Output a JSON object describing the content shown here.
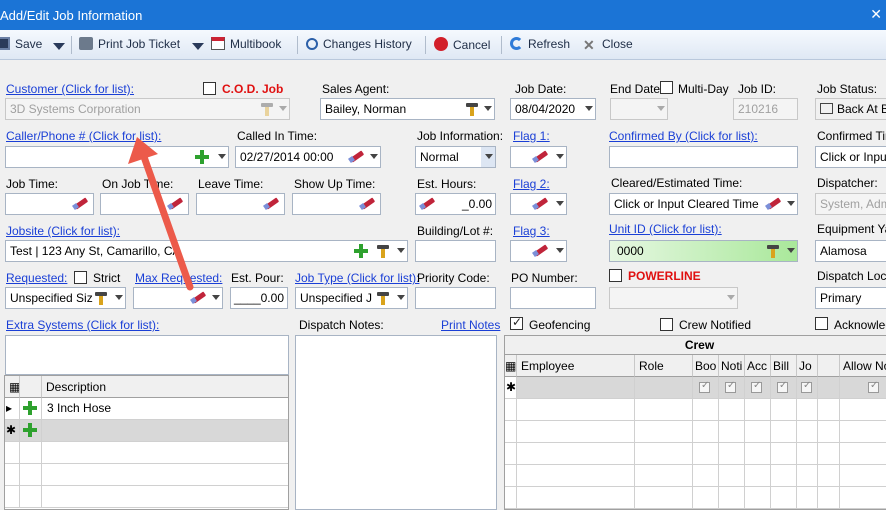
{
  "window": {
    "title": "Add/Edit Job Information",
    "close": "✕"
  },
  "toolbar": {
    "save": "Save",
    "print_ticket": "Print Job Ticket",
    "multibook": "Multibook",
    "changes_history": "Changes History",
    "cancel": "Cancel",
    "refresh": "Refresh",
    "close": "Close"
  },
  "customer": {
    "label": "Customer (Click for list):",
    "value": "3D Systems Corporation",
    "cod_label": "C.O.D. Job"
  },
  "sales_agent": {
    "label": "Sales Agent:",
    "value": "Bailey, Norman"
  },
  "job_date": {
    "label": "Job Date:",
    "value": "08/04/2020"
  },
  "end_date": {
    "label": "End Date:",
    "multi_day": "Multi-Day"
  },
  "job_id": {
    "label": "Job ID:",
    "value": "210216"
  },
  "job_status": {
    "label": "Job Status:",
    "value": "Back At B"
  },
  "caller": {
    "label": "Caller/Phone # (Click for list):",
    "value": ""
  },
  "called_in": {
    "label": "Called In Time:",
    "value": "02/27/2014 00:00"
  },
  "job_information": {
    "label": "Job Information:",
    "value": "Normal"
  },
  "flag1": {
    "label": "Flag 1:"
  },
  "confirmed_by": {
    "label": "Confirmed By (Click for list):"
  },
  "confirmed_time": {
    "label": "Confirmed Tim",
    "value": "Click or Input"
  },
  "times": {
    "job_time": "Job Time:",
    "on_job_time": "On Job Time:",
    "leave_time": "Leave Time:",
    "show_up_time": "Show Up Time:"
  },
  "est_hours": {
    "label": "Est. Hours:",
    "value": "_0.00"
  },
  "flag2": {
    "label": "Flag 2:"
  },
  "cleared_time": {
    "label": "Cleared/Estimated Time:",
    "value": "Click or Input Cleared Time"
  },
  "dispatcher": {
    "label": "Dispatcher:",
    "value": "System, Admi"
  },
  "jobsite": {
    "label": "Jobsite (Click for list):",
    "value": "Test | 123 Any St, Camarillo, CA"
  },
  "building_lot": {
    "label": "Building/Lot #:"
  },
  "flag3": {
    "label": "Flag 3:"
  },
  "unit_id": {
    "label": "Unit ID (Click for list):",
    "value": "0000"
  },
  "equipment_yard": {
    "label": "Equipment Yar",
    "value": "Alamosa"
  },
  "requested": {
    "label": "Requested:",
    "strict": "Strict",
    "value": "Unspecified Siz"
  },
  "max_requested": {
    "label": "Max Requested:"
  },
  "est_pour": {
    "label": "Est. Pour:",
    "value": "____0.00"
  },
  "job_type": {
    "label": "Job Type (Click for list):",
    "value": "Unspecified J"
  },
  "priority_code": {
    "label": "Priority Code:"
  },
  "po_number": {
    "label": "PO Number:"
  },
  "powerline": {
    "label": "POWERLINE"
  },
  "dispatch_location": {
    "label": "Dispatch Loca",
    "value": "Primary"
  },
  "extra_systems": {
    "label": "Extra Systems (Click for list):",
    "col_description": "Description",
    "rows": [
      "3 Inch Hose"
    ]
  },
  "dispatch_notes": {
    "label": "Dispatch Notes:",
    "print": "Print Notes"
  },
  "geofencing": {
    "label": "Geofencing"
  },
  "crew_notified": {
    "label": "Crew Notified"
  },
  "acknowledged": {
    "label": "Acknowled"
  },
  "crew": {
    "title": "Crew",
    "columns": [
      "Employee",
      "Role",
      "Boo",
      "Noti",
      "Acc",
      "Bill",
      "Jo",
      "",
      "Allow No"
    ]
  },
  "colors": {
    "title_bar": "#1b74d6",
    "link": "#1a3fd6",
    "alert_red": "#e01010",
    "unit_green": "#a9e89a"
  }
}
